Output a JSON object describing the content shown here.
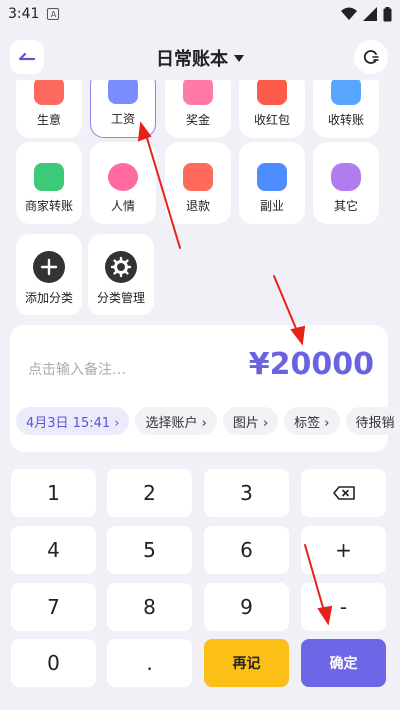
{
  "status": {
    "time": "3:41",
    "a_badge": "A"
  },
  "header": {
    "title": "日常账本"
  },
  "categories": [
    {
      "label": "生意",
      "color": "#ff6a5e"
    },
    {
      "label": "工资",
      "color": "#7b8cff"
    },
    {
      "label": "奖金",
      "color": "#ff7aa8"
    },
    {
      "label": "收红包",
      "color": "#ff5b4a"
    },
    {
      "label": "收转账",
      "color": "#58a6ff"
    },
    {
      "label": "商家转账",
      "color": "#3cc978"
    },
    {
      "label": "人情",
      "color": "#ff6aa0"
    },
    {
      "label": "退款",
      "color": "#ff6b5a"
    },
    {
      "label": "副业",
      "color": "#4f8dff"
    },
    {
      "label": "其它",
      "color": "#b07cf0"
    },
    {
      "label": "添加分类",
      "color": "#333333"
    },
    {
      "label": "分类管理",
      "color": "#333333"
    }
  ],
  "entry": {
    "note_placeholder": "点击输入备注…",
    "amount": "¥20000",
    "chips": [
      "4月3日 15:41 ›",
      "选择账户 ›",
      "图片 ›",
      "标签 ›",
      "待报销"
    ]
  },
  "keypad": {
    "keys": [
      "1",
      "2",
      "3",
      "4",
      "5",
      "6",
      "7",
      "8",
      "9",
      "0",
      "."
    ],
    "plus": "+",
    "minus": "-",
    "again": "再记",
    "confirm": "确定"
  },
  "accent": "#6a63e0",
  "arrow_color": "#e8201a"
}
